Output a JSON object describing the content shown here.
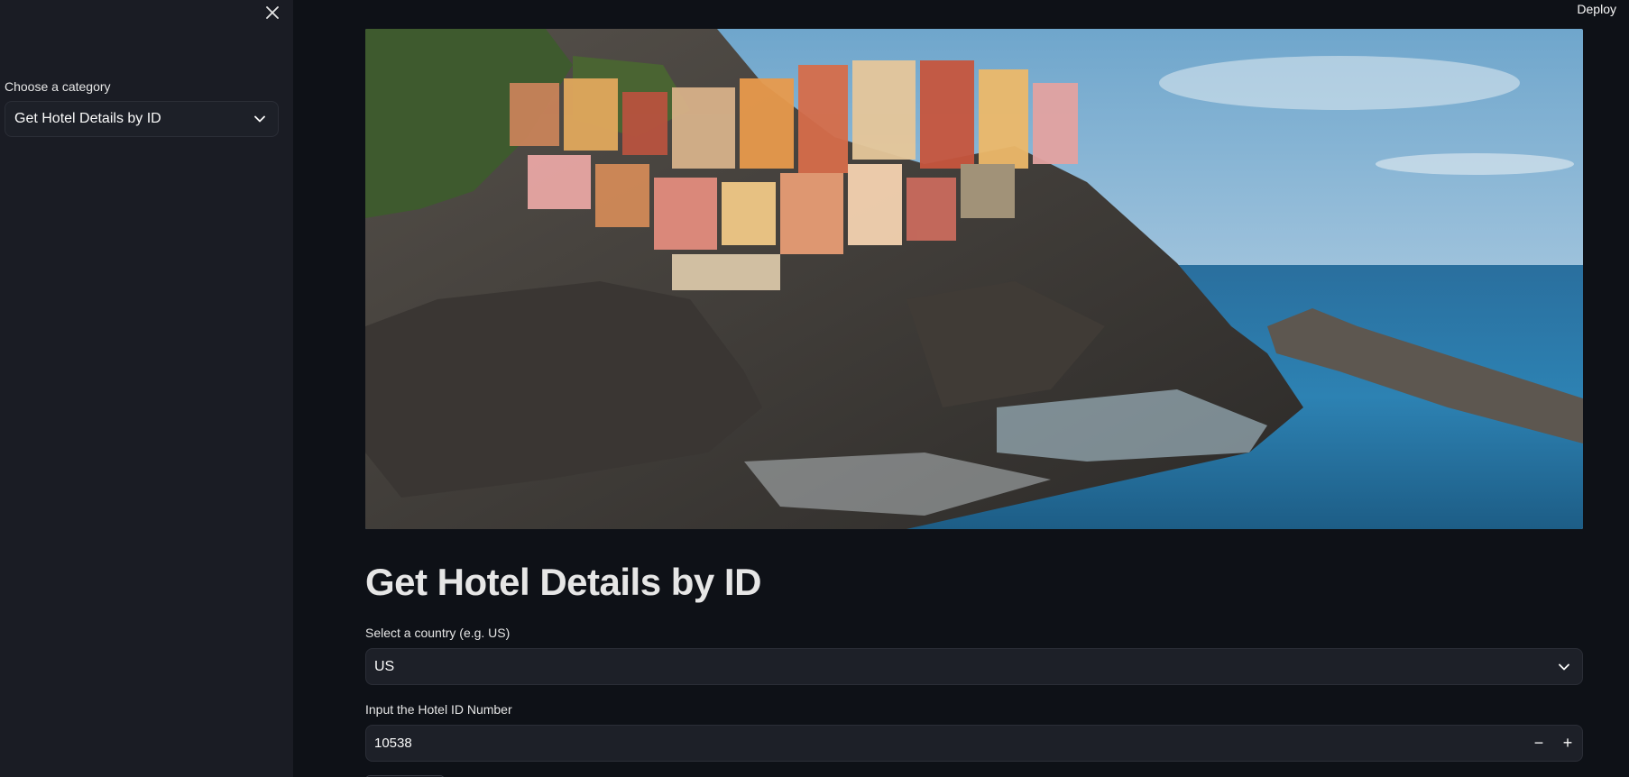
{
  "header": {
    "deploy_label": "Deploy"
  },
  "sidebar": {
    "category_label": "Choose a category",
    "category_value": "Get Hotel Details by ID"
  },
  "main": {
    "title": "Get Hotel Details by ID",
    "country": {
      "label": "Select a country (e.g. US)",
      "value": "US"
    },
    "hotel_id": {
      "label": "Input the Hotel ID Number",
      "value": "10538",
      "minus": "−",
      "plus": "+"
    }
  },
  "colors": {
    "background": "#0e1117",
    "sidebar": "#1a1c24",
    "input": "#1d2028"
  },
  "icons": [
    "close-icon",
    "chevron-down-icon",
    "minus-icon",
    "plus-icon"
  ]
}
